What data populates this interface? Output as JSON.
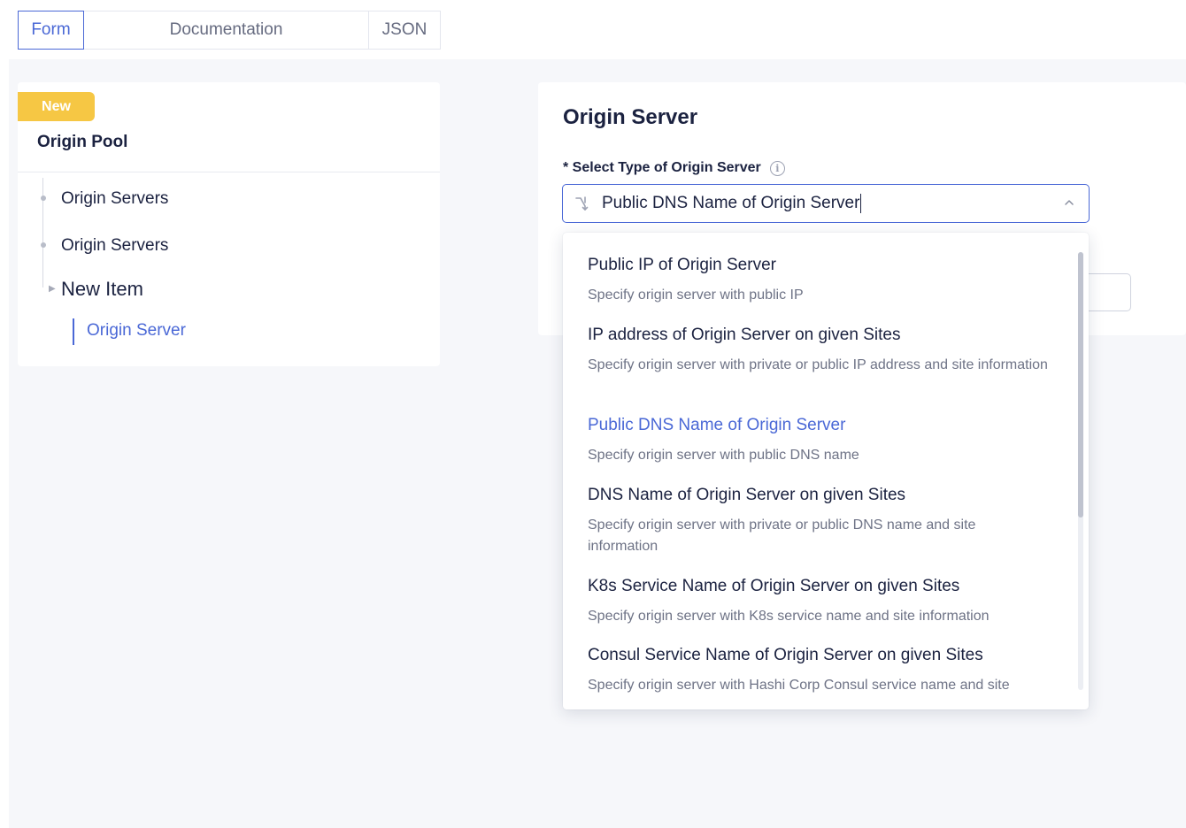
{
  "tabs": [
    {
      "label": "Form",
      "active": true
    },
    {
      "label": "Documentation",
      "active": false
    },
    {
      "label": "JSON",
      "active": false
    }
  ],
  "left_panel": {
    "badge": "New",
    "title": "Origin Pool",
    "tree": [
      {
        "label": "Origin Servers"
      },
      {
        "label": "Origin Servers"
      }
    ],
    "new_item": "New Item",
    "sub_item": "Origin Server"
  },
  "form": {
    "section_title": "Origin Server",
    "field_label": "* Select Type of Origin Server",
    "selected_value": "Public DNS Name of Origin Server",
    "info_icon": "info-icon"
  },
  "dropdown": {
    "options": [
      {
        "title": "Public IP of Origin Server",
        "desc": "Specify origin server with public IP",
        "selected": false
      },
      {
        "title": "IP address of Origin Server on given Sites",
        "desc": "Specify origin server with private or public IP address and site information",
        "selected": false
      },
      {
        "title": "Public DNS Name of Origin Server",
        "desc": "Specify origin server with public DNS name",
        "selected": true
      },
      {
        "title": "DNS Name of Origin Server on given Sites",
        "desc": "Specify origin server with private or public DNS name and site information",
        "selected": false
      },
      {
        "title": "K8s Service Name of Origin Server on given Sites",
        "desc": "Specify origin server with K8s service name and site information",
        "selected": false
      },
      {
        "title": "Consul Service Name of Origin Server on given Sites",
        "desc": "Specify origin server with Hashi Corp Consul service name and site",
        "selected": false
      }
    ]
  },
  "colors": {
    "accent": "#4a68d6",
    "badge": "#f6c744",
    "text": "#1b2240",
    "muted": "#6e7386"
  }
}
